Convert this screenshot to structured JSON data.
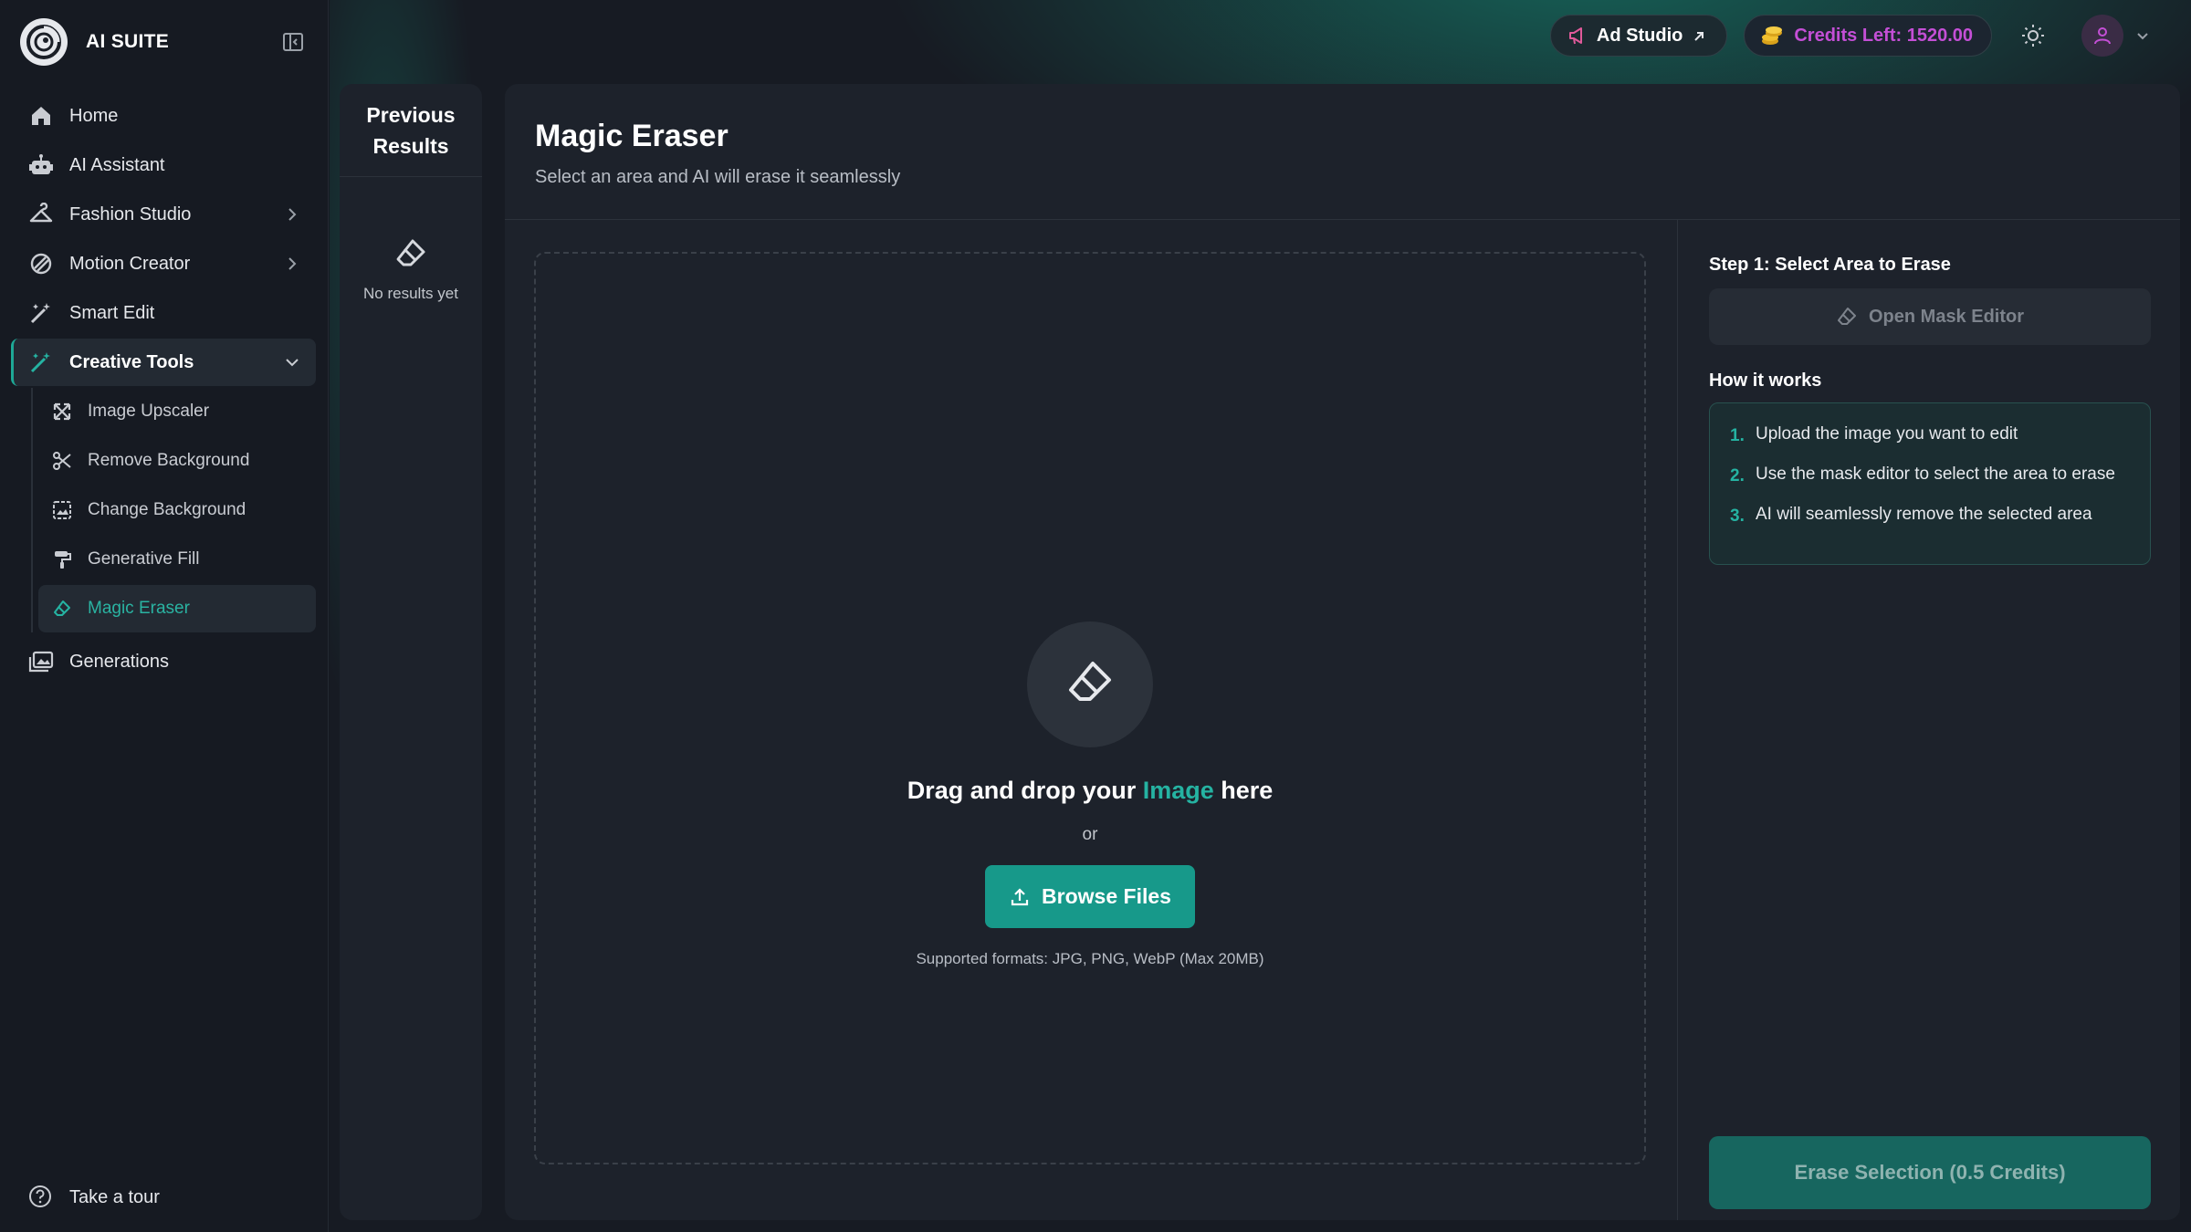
{
  "app": {
    "brand_title": "AI SUITE"
  },
  "sidebar": {
    "items": [
      {
        "label": "Home"
      },
      {
        "label": "AI Assistant"
      },
      {
        "label": "Fashion Studio"
      },
      {
        "label": "Motion Creator"
      },
      {
        "label": "Smart Edit"
      },
      {
        "label": "Creative Tools"
      },
      {
        "label": "Generations"
      }
    ],
    "creative_tools": [
      {
        "label": "Image Upscaler"
      },
      {
        "label": "Remove Background"
      },
      {
        "label": "Change Background"
      },
      {
        "label": "Generative Fill"
      },
      {
        "label": "Magic Eraser"
      }
    ],
    "tour_label": "Take a tour"
  },
  "topbar": {
    "ad_studio_label": "Ad Studio",
    "credits_label": "Credits Left: 1520.00"
  },
  "previous_results": {
    "title": "Previous\nResults",
    "empty_text": "No results yet"
  },
  "main": {
    "title": "Magic Eraser",
    "subtitle": "Select an area and AI will erase it seamlessly",
    "dropzone": {
      "headline_prefix": "Drag and drop your ",
      "headline_highlight": "Image",
      "headline_suffix": " here",
      "or_text": "or",
      "browse_label": "Browse Files",
      "formats_text": "Supported formats: JPG, PNG, WebP (Max 20MB)"
    },
    "right": {
      "step_label": "Step 1: Select Area to Erase",
      "mask_button_label": "Open Mask Editor",
      "how_label": "How it works",
      "steps": [
        {
          "num": "1.",
          "text": "Upload the image you want to edit"
        },
        {
          "num": "2.",
          "text": "Use the mask editor to select the area to erase"
        },
        {
          "num": "3.",
          "text": "AI will seamlessly remove the selected area"
        }
      ],
      "erase_button_label": "Erase Selection (0.5 Credits)"
    }
  },
  "colors": {
    "accent": "#17998a",
    "accent_text": "#25b3a2",
    "credits_text": "#c44fd6",
    "background": "#161a22",
    "panel": "#1d222b"
  },
  "icons": {
    "home": "home-icon",
    "assistant": "robot-icon",
    "fashion": "hanger-icon",
    "motion": "motion-icon",
    "smart_edit": "magic-wand-icon",
    "creative": "wand-sparkle-icon",
    "generations": "images-icon",
    "eraser": "eraser-icon"
  }
}
